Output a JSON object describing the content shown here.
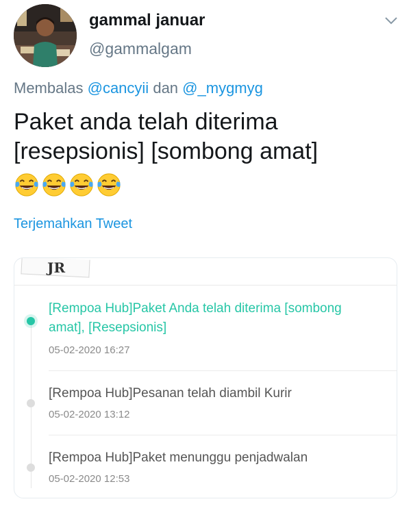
{
  "user": {
    "display_name": "gammal januar",
    "handle": "@gammalgam"
  },
  "reply": {
    "prefix": "Membalas",
    "mention1": "@cancyii",
    "joiner": "dan",
    "mention2": "@_mygmyg"
  },
  "tweet": {
    "text": "Paket anda telah diterima [resepsionis] [sombong amat]",
    "emojis": [
      "face-with-tears-of-joy-icon",
      "face-with-tears-of-joy-icon",
      "face-with-tears-of-joy-icon",
      "face-with-tears-of-joy-icon"
    ],
    "translate_label": "Terjemahkan Tweet"
  },
  "card": {
    "logo_fragment": "JR",
    "events": [
      {
        "message": "[Rempoa Hub]Paket Anda telah diterima [sombong amat], [Resepsionis]",
        "timestamp": "05-02-2020 16:27",
        "active": true
      },
      {
        "message": "[Rempoa Hub]Pesanan telah diambil Kurir",
        "timestamp": "05-02-2020 13:12",
        "active": false
      },
      {
        "message": "[Rempoa Hub]Paket menunggu penjadwalan",
        "timestamp": "05-02-2020 12:53",
        "active": false
      }
    ]
  },
  "colors": {
    "link_blue": "#1b95e0",
    "active_green": "#26c6a6",
    "muted_gray": "#657786"
  }
}
